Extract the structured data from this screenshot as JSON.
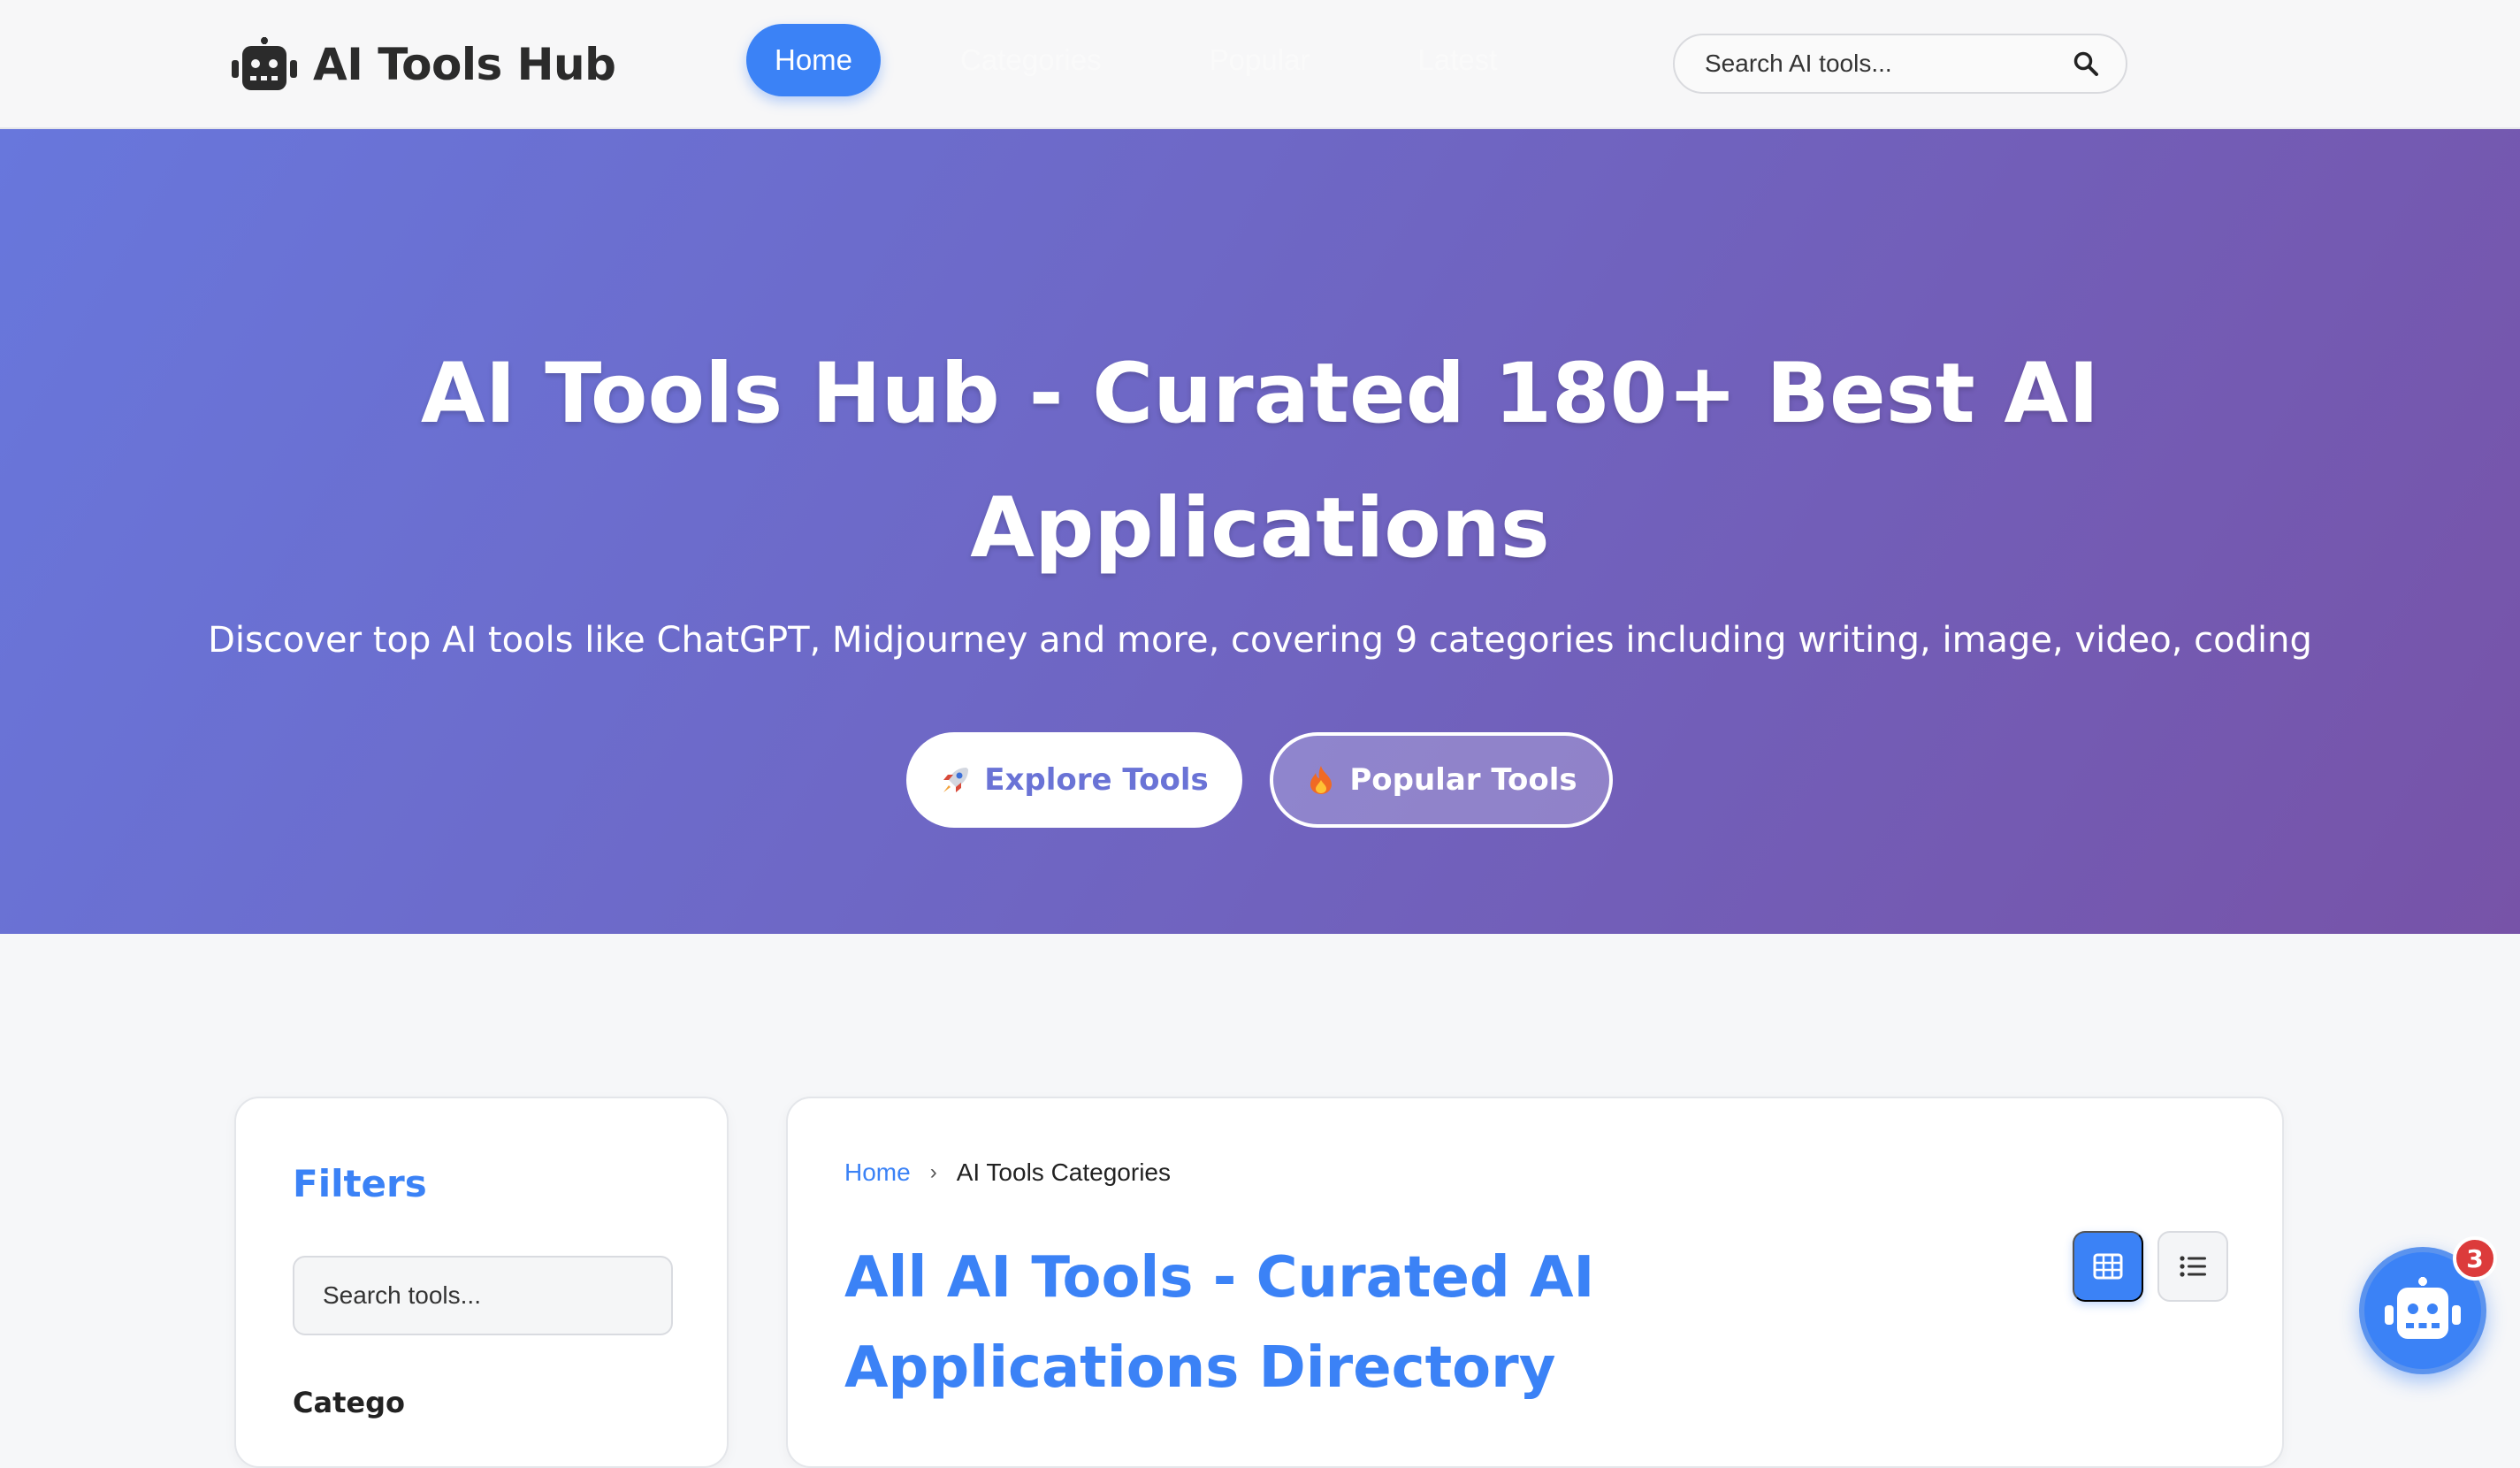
{
  "header": {
    "brand": "AI Tools Hub",
    "nav": [
      {
        "label": "Home",
        "active": true
      },
      {
        "label": "Categories",
        "active": false
      },
      {
        "label": "Popular",
        "active": false
      },
      {
        "label": "Latest",
        "active": false
      }
    ],
    "search_placeholder": "Search AI tools...",
    "icons": {
      "logo": "robot-icon",
      "search": "magnifier-icon"
    }
  },
  "hero": {
    "title": "AI Tools Hub - Curated 180+ Best AI Applications",
    "subtitle": "Discover top AI tools like ChatGPT, Midjourney and more, covering 9 categories including writing, image, video, coding",
    "explore_label": "Explore Tools",
    "popular_label": "Popular Tools",
    "icons": {
      "explore": "rocket-icon",
      "popular": "fire-icon"
    }
  },
  "sidebar": {
    "title": "Filters",
    "search_placeholder": "Search tools...",
    "cut_label": "Catego"
  },
  "main": {
    "breadcrumb": {
      "home": "Home",
      "separator": "›",
      "current": "AI Tools Categories"
    },
    "title": "All AI Tools - Curated AI Applications Directory",
    "icons": {
      "grid": "grid-view-icon",
      "list": "list-view-icon"
    }
  },
  "chat": {
    "badge": "3",
    "icon": "robot-icon"
  },
  "colors": {
    "accent": "#3b82f6",
    "hero_start": "#6877dc",
    "hero_end": "#7753a8",
    "badge": "#dc3b3b"
  }
}
